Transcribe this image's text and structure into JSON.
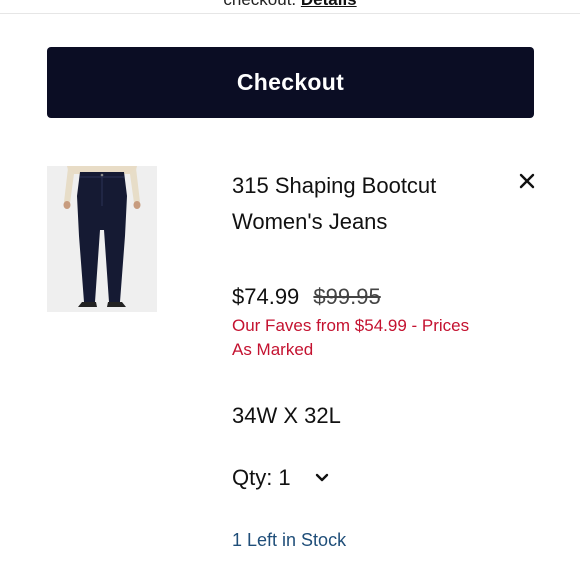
{
  "notice": {
    "text": "checkout.",
    "link": "Details"
  },
  "checkout": {
    "label": "Checkout"
  },
  "item": {
    "title": "315 Shaping Bootcut Women's Jeans",
    "price": "$74.99",
    "original_price": "$99.95",
    "promo": "Our Faves from $54.99 - Prices As Marked",
    "size": "34W X 32L",
    "qty_label": "Qty:",
    "qty_value": "1",
    "stock": "1 Left in Stock"
  },
  "icons": {
    "remove": "close-icon",
    "qty": "chevron-down-icon"
  },
  "colors": {
    "checkout_bg": "#0b0d24",
    "promo": "#c41230",
    "stock": "#1f4e79"
  }
}
